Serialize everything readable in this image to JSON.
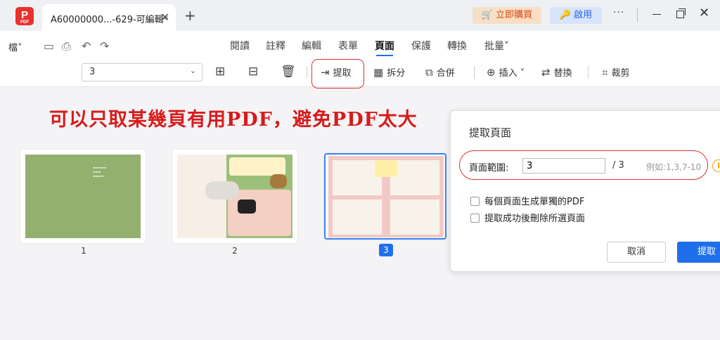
{
  "titlebar": {
    "logo_text": "PDF",
    "tab_title": "A60000000...-629-可編輯*",
    "tab_close": "✕",
    "new_tab": "+",
    "buy_label": "🛒 立即購買",
    "bind_label": "啟用",
    "more": "···",
    "close": "✕"
  },
  "menu": {
    "file": "檔˅",
    "items": [
      "閱讀",
      "註釋",
      "編輯",
      "表單",
      "頁面",
      "保護",
      "轉換",
      "批量˅"
    ],
    "active": "頁面"
  },
  "toolbar": {
    "page_value": "3",
    "extract": "提取",
    "split": "拆分",
    "merge": "合併",
    "insert": "插入",
    "replace": "替換",
    "crop": "裁剪"
  },
  "banner": "可以只取某幾頁有用PDF，避免PDF太大",
  "pages": [
    {
      "num": "1",
      "selected": false
    },
    {
      "num": "2",
      "selected": false
    },
    {
      "num": "3",
      "selected": true
    }
  ],
  "dialog": {
    "title": "提取頁面",
    "range_label": "頁面範圍:",
    "range_value": "3",
    "total": "/ 3",
    "example": "例如:1,3,7-10",
    "option1": "每個頁面生成單獨的PDF",
    "option2": "提取成功後刪除所選頁面",
    "cancel": "取消",
    "ok": "提取"
  },
  "colors": {
    "accent": "#1f6feb",
    "annotation_red": "#d33333",
    "banner_red": "#d81b1b"
  }
}
